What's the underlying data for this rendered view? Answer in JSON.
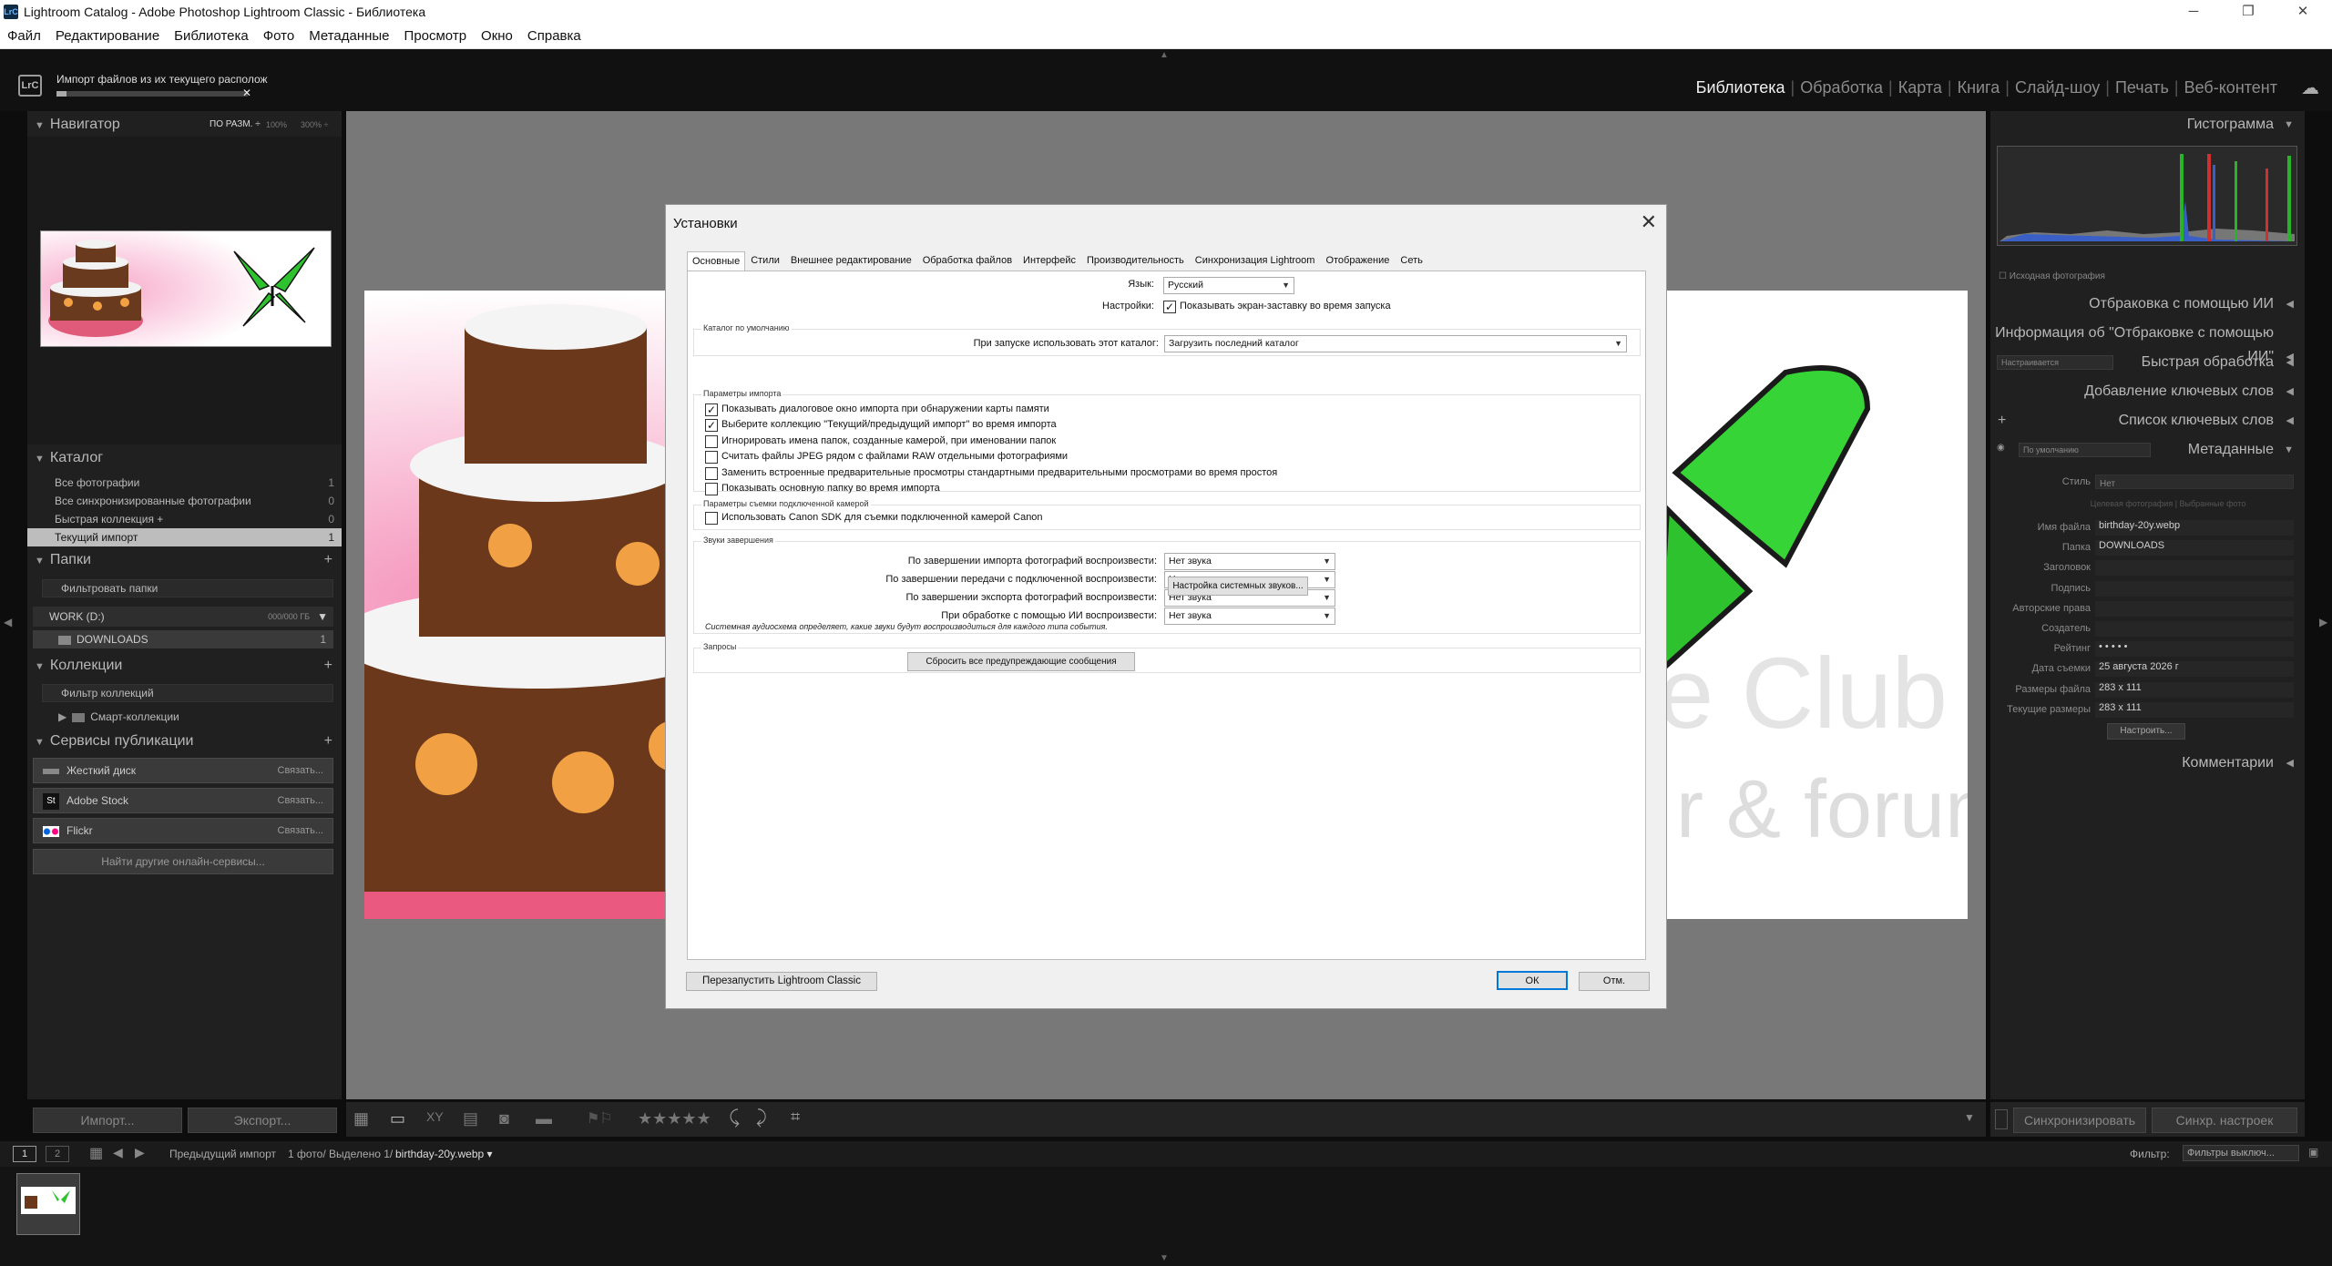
{
  "window": {
    "title": "Lightroom Catalog - Adobe Photoshop Lightroom Classic - Библиотека",
    "app_icon": "LrC",
    "minimize": "─",
    "maximize": "❐",
    "close": "✕"
  },
  "menu": [
    "Файл",
    "Редактирование",
    "Библиотека",
    "Фото",
    "Метаданные",
    "Просмотр",
    "Окно",
    "Справка"
  ],
  "identity": {
    "logo": "LrC",
    "progress_text": "Импорт файлов из их текущего располож",
    "progress_fraction": 0.05,
    "cancel": "✕"
  },
  "modules": [
    "Библиотека",
    "Обработка",
    "Карта",
    "Книга",
    "Слайд-шоу",
    "Печать",
    "Веб-контент"
  ],
  "left": {
    "navigator": {
      "title": "Навигатор",
      "zoom": [
        "ПО РАЗМ. ÷",
        "100%",
        "300% ÷"
      ]
    },
    "catalog": {
      "title": "Каталог",
      "items": [
        {
          "label": "Все фотографии",
          "count": "1"
        },
        {
          "label": "Все синхронизированные фотографии",
          "count": "0"
        },
        {
          "label": "Быстрая коллекция +",
          "count": "0"
        },
        {
          "label": "Текущий импорт",
          "count": "1"
        }
      ]
    },
    "folders": {
      "title": "Папки",
      "add": "+",
      "filter": "Фильтровать папки",
      "volume": "WORK (D:)",
      "volume_size": "000/000 ГБ",
      "folder": "DOWNLOADS",
      "folder_count": "1"
    },
    "collections": {
      "title": "Коллекции",
      "add": "+",
      "filter": "Фильтр коллекций",
      "smart": "Смарт-коллекции"
    },
    "publish": {
      "title": "Сервисы публикации",
      "add": "+",
      "services": [
        {
          "label": "Жесткий диск",
          "link": "Связать..."
        },
        {
          "label": "Adobe Stock",
          "link": "Связать..."
        },
        {
          "label": "Flickr",
          "link": "Связать..."
        }
      ],
      "find_more": "Найти другие онлайн-сервисы..."
    }
  },
  "right": {
    "histogram": {
      "title": "Гистограмма",
      "original_photo": "Исходная фотография"
    },
    "sections": [
      "Отбраковка с помощью ИИ",
      "Информация об \"Отбраковке с помощью ИИ\"",
      "Быстрая обработка",
      "Добавление ключевых слов",
      "Список ключевых слов",
      "Метаданные",
      "Комментарии"
    ],
    "quick_preset": "Настраивается",
    "metadata_preset": "По умолчанию",
    "metadata": {
      "style_label": "Стиль",
      "style_value": "Нет",
      "tabs": "Целевая фотография  |  Выбранные фото",
      "rows": [
        {
          "label": "Имя файла",
          "value": "birthday-20y.webp"
        },
        {
          "label": "Папка",
          "value": "DOWNLOADS"
        },
        {
          "label": "Заголовок",
          "value": ""
        },
        {
          "label": "Подпись",
          "value": ""
        },
        {
          "label": "Авторские права",
          "value": ""
        },
        {
          "label": "Создатель",
          "value": ""
        },
        {
          "label": "Рейтинг",
          "value": "• • • • •"
        },
        {
          "label": "Дата съемки",
          "value": "25 августа 2026 г"
        },
        {
          "label": "Размеры файла",
          "value": "283 x 111"
        },
        {
          "label": "Текущие размеры",
          "value": "283 x 111"
        }
      ],
      "customize": "Настроить..."
    }
  },
  "bottom": {
    "import": "Импорт...",
    "export": "Экспорт...",
    "sync": "Синхронизировать",
    "sync_settings": "Синхр. настроек",
    "stars": "★★★★★",
    "filmstrip": {
      "source": "Предыдущий импорт",
      "info": "1 фото/ Выделено 1/",
      "file": "birthday-20y.webp ▾",
      "filter_label": "Фильтр:",
      "filter_value": "Фильтры выключ...",
      "page1": "1",
      "page2": "2"
    }
  },
  "dialog": {
    "title": "Установки",
    "close": "✕",
    "tabs": [
      "Основные",
      "Стили",
      "Внешнее редактирование",
      "Обработка файлов",
      "Интерфейс",
      "Производительность",
      "Синхронизация Lightroom",
      "Отображение",
      "Сеть"
    ],
    "language_label": "Язык:",
    "language_value": "Русский",
    "settings_label": "Настройки:",
    "splash": "Показывать экран-заставку во время запуска",
    "catalog_group": "Каталог по умолчанию",
    "catalog_label": "При запуске использовать этот каталог:",
    "catalog_value": "Загрузить последний каталог",
    "import_group": "Параметры импорта",
    "import_opts": [
      {
        "label": "Показывать диалоговое окно импорта при обнаружении карты памяти",
        "checked": true
      },
      {
        "label": "Выберите коллекцию \"Текущий/предыдущий импорт\" во время импорта",
        "checked": true
      },
      {
        "label": "Игнорировать имена папок, созданные камерой, при именовании папок",
        "checked": false
      },
      {
        "label": "Считать файлы JPEG рядом с файлами RAW отдельными фотографиями",
        "checked": false
      },
      {
        "label": "Заменить встроенные предварительные просмотры стандартными предварительными просмотрами во время простоя",
        "checked": false
      },
      {
        "label": "Показывать основную папку во время импорта",
        "checked": false
      }
    ],
    "tether_group": "Параметры съемки подключенной камерой",
    "tether_opt": "Использовать Canon SDK для съемки подключенной камерой Canon",
    "sound_group": "Звуки завершения",
    "sounds": [
      {
        "label": "По завершении импорта фотографий воспроизвести:",
        "value": "Нет звука"
      },
      {
        "label": "По завершении передачи с подключенной воспроизвести:",
        "value": "Нет звука"
      },
      {
        "label": "По завершении экспорта фотографий воспроизвести:",
        "value": "Нет звука"
      },
      {
        "label": "При обработке с помощью ИИ воспроизвести:",
        "value": "Нет звука"
      }
    ],
    "system_sounds": "Настройка системных звуков...",
    "sound_note": "Системная аудиосхема определяет, какие звуки будут воспроизводиться для каждого типа события.",
    "prompts_group": "Запросы",
    "reset_warnings": "Сбросить все предупреждающие сообщения",
    "restart": "Перезапустить Lightroom Classic",
    "ok": "ОК",
    "cancel": "Отм."
  },
  "colors": {
    "chrome": "#202020",
    "center": "#787878",
    "accent": "#0078d7"
  }
}
